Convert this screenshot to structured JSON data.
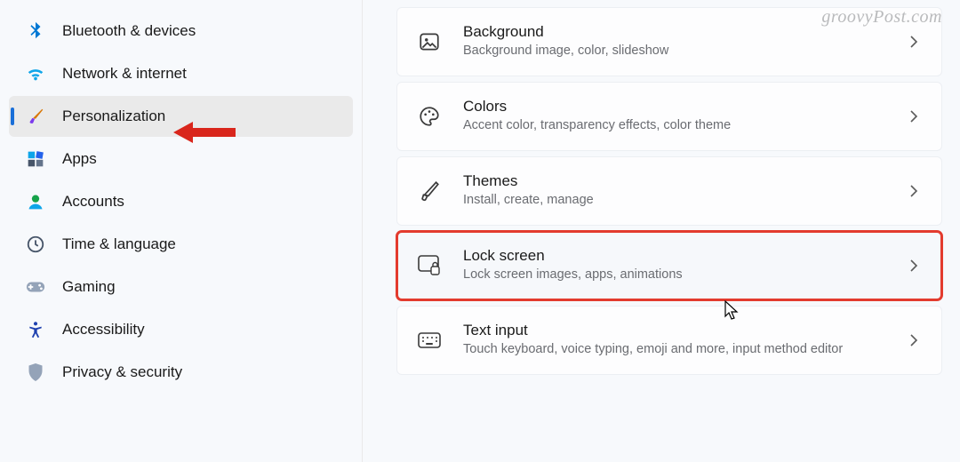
{
  "watermark": "groovyPost.com",
  "sidebar": {
    "items": [
      {
        "label": "Bluetooth & devices",
        "icon": "bluetooth-icon",
        "active": false
      },
      {
        "label": "Network & internet",
        "icon": "wifi-icon",
        "active": false
      },
      {
        "label": "Personalization",
        "icon": "paintbrush-icon",
        "active": true
      },
      {
        "label": "Apps",
        "icon": "apps-icon",
        "active": false
      },
      {
        "label": "Accounts",
        "icon": "person-icon",
        "active": false
      },
      {
        "label": "Time & language",
        "icon": "clock-globe-icon",
        "active": false
      },
      {
        "label": "Gaming",
        "icon": "gamepad-icon",
        "active": false
      },
      {
        "label": "Accessibility",
        "icon": "accessibility-icon",
        "active": false
      },
      {
        "label": "Privacy & security",
        "icon": "shield-icon",
        "active": false
      }
    ]
  },
  "rows": [
    {
      "title": "Background",
      "subtitle": "Background image, color, slideshow",
      "icon": "image-icon",
      "highlighted": false
    },
    {
      "title": "Colors",
      "subtitle": "Accent color, transparency effects, color theme",
      "icon": "palette-icon",
      "highlighted": false
    },
    {
      "title": "Themes",
      "subtitle": "Install, create, manage",
      "icon": "brush-icon",
      "highlighted": false
    },
    {
      "title": "Lock screen",
      "subtitle": "Lock screen images, apps, animations",
      "icon": "lockscreen-icon",
      "highlighted": true
    },
    {
      "title": "Text input",
      "subtitle": "Touch keyboard, voice typing, emoji and more, input method editor",
      "icon": "keyboard-icon",
      "highlighted": false
    }
  ]
}
